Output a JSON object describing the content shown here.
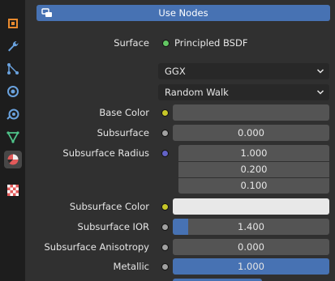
{
  "sidebar_tabs": [
    {
      "name": "object-tab",
      "icon": "object-icon"
    },
    {
      "name": "modifier-tab",
      "icon": "wrench-icon"
    },
    {
      "name": "particles-tab",
      "icon": "particles-icon"
    },
    {
      "name": "physics-tab",
      "icon": "physics-icon"
    },
    {
      "name": "constraints-tab",
      "icon": "constraints-icon"
    },
    {
      "name": "data-tab",
      "icon": "mesh-data-icon"
    },
    {
      "name": "material-tab",
      "icon": "material-icon",
      "active": true
    },
    {
      "name": "texture-tab",
      "icon": "texture-icon"
    }
  ],
  "header": {
    "label": "Use Nodes"
  },
  "surface": {
    "label": "Surface",
    "value": "Principled BSDF"
  },
  "dropdowns": {
    "distribution": "GGX",
    "subsurface_method": "Random Walk"
  },
  "properties": {
    "base_color": {
      "label": "Base Color",
      "color": "#545454"
    },
    "subsurface": {
      "label": "Subsurface",
      "value": "0.000"
    },
    "subsurface_radius": {
      "label": "Subsurface Radius",
      "values": [
        "1.000",
        "0.200",
        "0.100"
      ]
    },
    "subsurface_color": {
      "label": "Subsurface Color",
      "color": "#e8e8e8"
    },
    "subsurface_ior": {
      "label": "Subsurface IOR",
      "value": "1.400",
      "fill_fraction": 0.1
    },
    "subsurface_anisotropy": {
      "label": "Subsurface Anisotropy",
      "value": "0.000"
    },
    "metallic": {
      "label": "Metallic",
      "value": "1.000",
      "fill_fraction": 1.0
    }
  },
  "colors": {
    "accent": "#4772b3",
    "socket_color": "#c7c729",
    "socket_float": "#a1a1a1",
    "socket_vector": "#6363c7",
    "socket_shader": "#63c763"
  }
}
